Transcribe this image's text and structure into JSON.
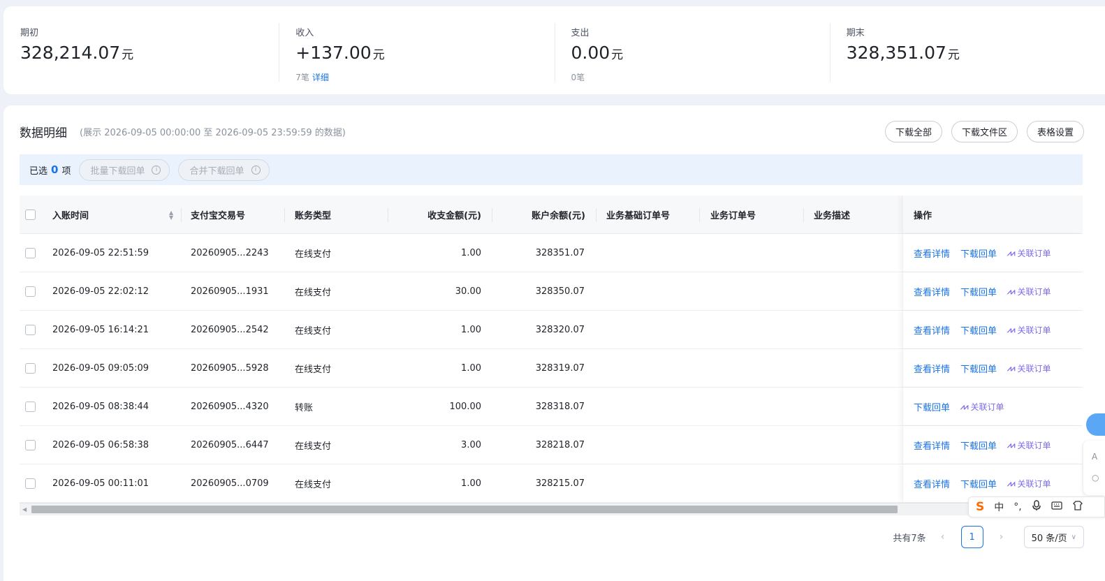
{
  "summary": [
    {
      "label": "期初",
      "value": "328,214.07",
      "unit": "元",
      "sub_text": "",
      "sub_link": ""
    },
    {
      "label": "收入",
      "value": "+137.00",
      "unit": "元",
      "sub_text": "7笔",
      "sub_link": "详细"
    },
    {
      "label": "支出",
      "value": "0.00",
      "unit": "元",
      "sub_text": "0笔",
      "sub_link": ""
    },
    {
      "label": "期末",
      "value": "328,351.07",
      "unit": "元",
      "sub_text": "",
      "sub_link": ""
    }
  ],
  "detail": {
    "title": "数据明细",
    "range": "(展示 2026-09-05 00:00:00 至 2026-09-05 23:59:59 的数据)",
    "actions": [
      "下载全部",
      "下载文件区",
      "表格设置"
    ]
  },
  "selection": {
    "prefix": "已选",
    "count": "0",
    "suffix": "项",
    "batch_download": "批量下载回单",
    "merge_download": "合并下载回单"
  },
  "table": {
    "columns": [
      "入账时间",
      "支付宝交易号",
      "账务类型",
      "收支金额(元)",
      "账户余额(元)",
      "业务基础订单号",
      "业务订单号",
      "业务描述",
      "操作"
    ],
    "rows": [
      {
        "time": "2026-09-05 22:51:59",
        "trade_no": "20260905...2243",
        "type": "在线支付",
        "amount": "1.00",
        "balance": "328351.07",
        "base_order": "",
        "order": "",
        "desc": "",
        "ops": [
          "查看详情",
          "下载回单"
        ],
        "link_order": "关联订单"
      },
      {
        "time": "2026-09-05 22:02:12",
        "trade_no": "20260905...1931",
        "type": "在线支付",
        "amount": "30.00",
        "balance": "328350.07",
        "base_order": "",
        "order": "",
        "desc": "",
        "ops": [
          "查看详情",
          "下载回单"
        ],
        "link_order": "关联订单"
      },
      {
        "time": "2026-09-05 16:14:21",
        "trade_no": "20260905...2542",
        "type": "在线支付",
        "amount": "1.00",
        "balance": "328320.07",
        "base_order": "",
        "order": "",
        "desc": "",
        "ops": [
          "查看详情",
          "下载回单"
        ],
        "link_order": "关联订单"
      },
      {
        "time": "2026-09-05 09:05:09",
        "trade_no": "20260905...5928",
        "type": "在线支付",
        "amount": "1.00",
        "balance": "328319.07",
        "base_order": "",
        "order": "",
        "desc": "",
        "ops": [
          "查看详情",
          "下载回单"
        ],
        "link_order": "关联订单"
      },
      {
        "time": "2026-09-05 08:38:44",
        "trade_no": "20260905...4320",
        "type": "转账",
        "amount": "100.00",
        "balance": "328318.07",
        "base_order": "",
        "order": "",
        "desc": "",
        "ops": [
          "下载回单"
        ],
        "link_order": "关联订单"
      },
      {
        "time": "2026-09-05 06:58:38",
        "trade_no": "20260905...6447",
        "type": "在线支付",
        "amount": "3.00",
        "balance": "328218.07",
        "base_order": "",
        "order": "",
        "desc": "",
        "ops": [
          "查看详情",
          "下载回单"
        ],
        "link_order": "关联订单"
      },
      {
        "time": "2026-09-05 00:11:01",
        "trade_no": "20260905...0709",
        "type": "在线支付",
        "amount": "1.00",
        "balance": "328215.07",
        "base_order": "",
        "order": "",
        "desc": "",
        "ops": [
          "查看详情",
          "下载回单"
        ],
        "link_order": "关联订单"
      }
    ]
  },
  "pagination": {
    "total": "共有7条",
    "current_page": "1",
    "page_size": "50 条/页"
  },
  "ime": {
    "logo": "S",
    "lang": "中",
    "punct": "°,"
  },
  "colors": {
    "accent": "#1a73e8",
    "link_order": "#7d6ef0",
    "selection_bar": "#eaf2fd"
  }
}
